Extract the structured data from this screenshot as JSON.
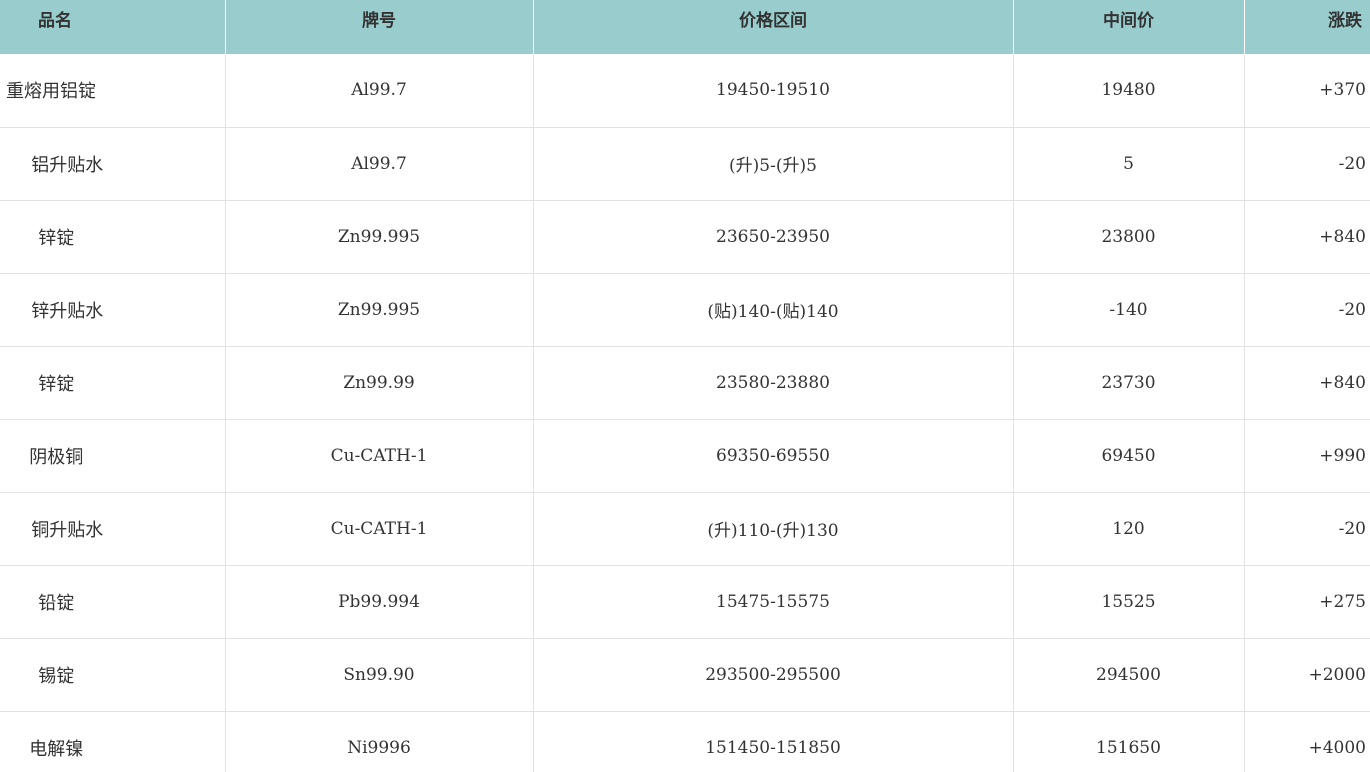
{
  "table": {
    "headers": [
      "品名",
      "牌号",
      "价格区间",
      "中间价",
      "涨跌"
    ],
    "rows": [
      {
        "name": "重熔用铝锭",
        "grade": "Al99.7",
        "range": "19450-19510",
        "mid": "19480",
        "change": "+370"
      },
      {
        "name": "铝升贴水",
        "grade": "Al99.7",
        "range": "(升)5-(升)5",
        "mid": "5",
        "change": "-20"
      },
      {
        "name": "锌锭",
        "grade": "Zn99.995",
        "range": "23650-23950",
        "mid": "23800",
        "change": "+840"
      },
      {
        "name": "锌升贴水",
        "grade": "Zn99.995",
        "range": "(贴)140-(贴)140",
        "mid": "-140",
        "change": "-20"
      },
      {
        "name": "锌锭",
        "grade": "Zn99.99",
        "range": "23580-23880",
        "mid": "23730",
        "change": "+840"
      },
      {
        "name": "阴极铜",
        "grade": "Cu-CATH-1",
        "range": "69350-69550",
        "mid": "69450",
        "change": "+990"
      },
      {
        "name": "铜升贴水",
        "grade": "Cu-CATH-1",
        "range": "(升)110-(升)130",
        "mid": "120",
        "change": "-20"
      },
      {
        "name": "铅锭",
        "grade": "Pb99.994",
        "range": "15475-15575",
        "mid": "15525",
        "change": "+275"
      },
      {
        "name": "锡锭",
        "grade": "Sn99.90",
        "range": "293500-295500",
        "mid": "294500",
        "change": "+2000"
      },
      {
        "name": "电解镍",
        "grade": "Ni9996",
        "range": "151450-151850",
        "mid": "151650",
        "change": "+4000"
      }
    ]
  },
  "colors": {
    "header_bg": "#99cccc",
    "text": "#333333",
    "grid": "#e2e2e2"
  }
}
